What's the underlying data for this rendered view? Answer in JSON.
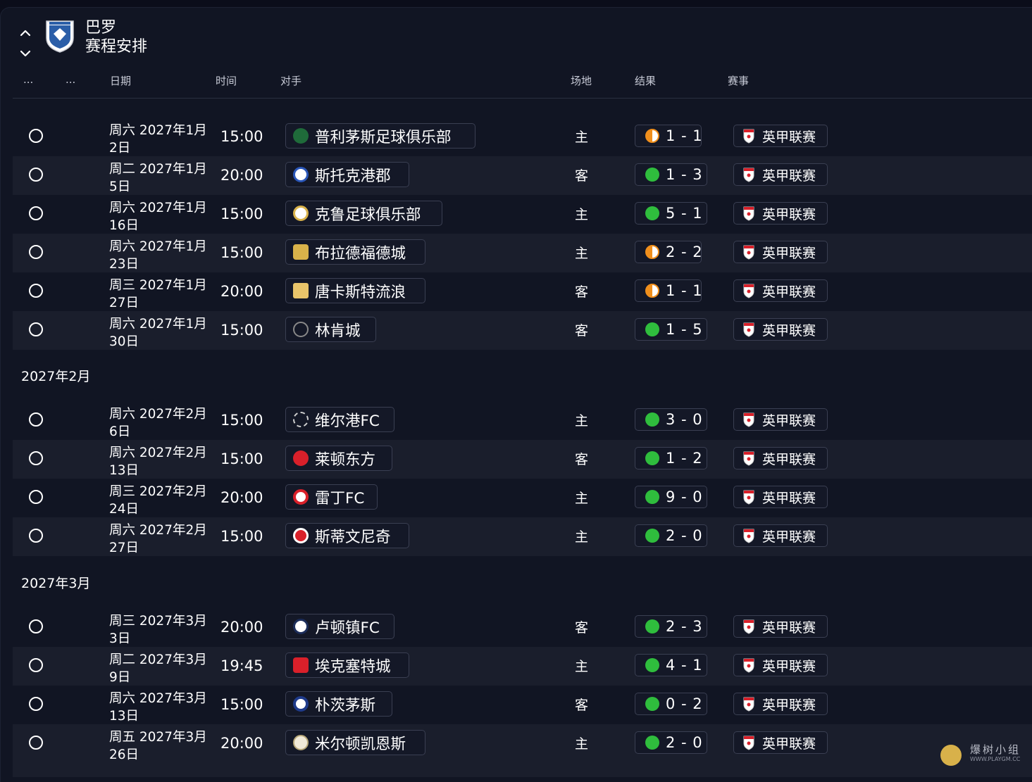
{
  "header": {
    "club_name": "巴罗",
    "page_title": "赛程安排"
  },
  "columns": {
    "col1": "...",
    "col2": "...",
    "date": "日期",
    "time": "时间",
    "opponent": "对手",
    "venue": "场地",
    "result": "结果",
    "competition": "赛事"
  },
  "colors": {
    "win": "#2fbd3d",
    "draw": "#f08f1c",
    "background": "#111523",
    "row_alt": "#1a1e2c"
  },
  "groups": [
    {
      "month": "",
      "matches": [
        {
          "date1": "周六 2027年1月",
          "date2": "2日",
          "time": "15:00",
          "opponent": "普利茅斯足球俱乐部",
          "badge_icon": "plymouth-crest-icon",
          "venue": "主",
          "outcome": "draw",
          "score": "1 - 1",
          "competition": "英甲联赛"
        },
        {
          "date1": "周二 2027年1月",
          "date2": "5日",
          "time": "20:00",
          "opponent": "斯托克港郡",
          "badge_icon": "stockport-crest-icon",
          "venue": "客",
          "outcome": "win",
          "score": "1 - 3",
          "competition": "英甲联赛"
        },
        {
          "date1": "周六 2027年1月",
          "date2": "16日",
          "time": "15:00",
          "opponent": "克鲁足球俱乐部",
          "badge_icon": "crewe-crest-icon",
          "venue": "主",
          "outcome": "win",
          "score": "5 - 1",
          "competition": "英甲联赛"
        },
        {
          "date1": "周六 2027年1月",
          "date2": "23日",
          "time": "15:00",
          "opponent": "布拉德福德城",
          "badge_icon": "bradford-crest-icon",
          "venue": "主",
          "outcome": "draw",
          "score": "2 - 2",
          "competition": "英甲联赛"
        },
        {
          "date1": "周三 2027年1月",
          "date2": "27日",
          "time": "20:00",
          "opponent": "唐卡斯特流浪",
          "badge_icon": "doncaster-crest-icon",
          "venue": "客",
          "outcome": "draw",
          "score": "1 - 1",
          "competition": "英甲联赛"
        },
        {
          "date1": "周六 2027年1月",
          "date2": "30日",
          "time": "15:00",
          "opponent": "林肯城",
          "badge_icon": "lincoln-crest-icon",
          "venue": "客",
          "outcome": "win",
          "score": "1 - 5",
          "competition": "英甲联赛"
        }
      ]
    },
    {
      "month": "2027年2月",
      "matches": [
        {
          "date1": "周六 2027年2月",
          "date2": "6日",
          "time": "15:00",
          "opponent": "维尔港FC",
          "badge_icon": "port-vale-crest-icon",
          "venue": "主",
          "outcome": "win",
          "score": "3 - 0",
          "competition": "英甲联赛"
        },
        {
          "date1": "周六 2027年2月",
          "date2": "13日",
          "time": "15:00",
          "opponent": "莱顿东方",
          "badge_icon": "leyton-orient-crest-icon",
          "venue": "客",
          "outcome": "win",
          "score": "1 - 2",
          "competition": "英甲联赛"
        },
        {
          "date1": "周三 2027年2月",
          "date2": "24日",
          "time": "20:00",
          "opponent": "雷丁FC",
          "badge_icon": "reading-crest-icon",
          "venue": "主",
          "outcome": "win",
          "score": "9 - 0",
          "competition": "英甲联赛"
        },
        {
          "date1": "周六 2027年2月",
          "date2": "27日",
          "time": "15:00",
          "opponent": "斯蒂文尼奇",
          "badge_icon": "stevenage-crest-icon",
          "venue": "主",
          "outcome": "win",
          "score": "2 - 0",
          "competition": "英甲联赛"
        }
      ]
    },
    {
      "month": "2027年3月",
      "matches": [
        {
          "date1": "周三 2027年3月",
          "date2": "3日",
          "time": "20:00",
          "opponent": "卢顿镇FC",
          "badge_icon": "luton-crest-icon",
          "venue": "客",
          "outcome": "win",
          "score": "2 - 3",
          "competition": "英甲联赛"
        },
        {
          "date1": "周二 2027年3月",
          "date2": "9日",
          "time": "19:45",
          "opponent": "埃克塞特城",
          "badge_icon": "exeter-crest-icon",
          "venue": "主",
          "outcome": "win",
          "score": "4 - 1",
          "competition": "英甲联赛"
        },
        {
          "date1": "周六 2027年3月",
          "date2": "13日",
          "time": "15:00",
          "opponent": "朴茨茅斯",
          "badge_icon": "portsmouth-crest-icon",
          "venue": "客",
          "outcome": "win",
          "score": "0 - 2",
          "competition": "英甲联赛"
        },
        {
          "date1": "周五 2027年3月",
          "date2": "26日",
          "time": "20:00",
          "opponent": "米尔顿凯恩斯",
          "badge_icon": "mk-dons-crest-icon",
          "venue": "主",
          "outcome": "win",
          "score": "2 - 0",
          "competition": "英甲联赛"
        }
      ]
    }
  ],
  "watermark": {
    "text": "爆树小组",
    "url": "WWW.PLAYGM.CC"
  }
}
